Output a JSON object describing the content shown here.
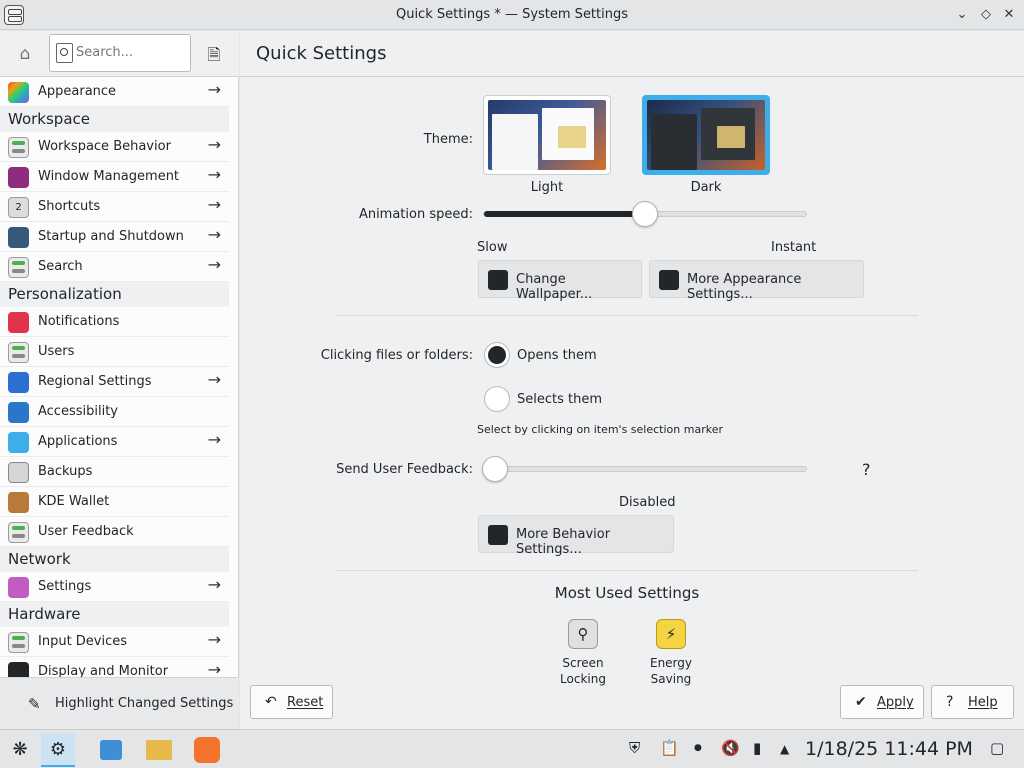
{
  "window": {
    "title": "Quick Settings * — System Settings"
  },
  "sidebar": {
    "search_placeholder": "Search...",
    "sections": {
      "appearance": "Appearance",
      "workspace_header": "Workspace",
      "workspace_items": [
        "Workspace Behavior",
        "Window Management",
        "Shortcuts",
        "Startup and Shutdown",
        "Search"
      ],
      "personalization_header": "Personalization",
      "personalization_items": [
        "Notifications",
        "Users",
        "Regional Settings",
        "Accessibility",
        "Applications",
        "Backups",
        "KDE Wallet",
        "User Feedback"
      ],
      "network_header": "Network",
      "network_items": [
        "Settings"
      ],
      "hardware_header": "Hardware",
      "hardware_items": [
        "Input Devices",
        "Display and Monitor"
      ]
    },
    "highlight_label": "Highlight Changed Settings"
  },
  "main": {
    "title": "Quick Settings",
    "theme_label": "Theme:",
    "themes": [
      "Light",
      "Dark"
    ],
    "selected_theme": "Dark",
    "animation_label": "Animation speed:",
    "animation_value": 0.5,
    "anim_slow": "Slow",
    "anim_instant": "Instant",
    "change_wallpaper": "Change Wallpaper...",
    "more_appearance": "More Appearance Settings...",
    "clicking_label": "Clicking files or folders:",
    "opens_them": "Opens them",
    "selects_them": "Selects them",
    "selects_hint": "Select by clicking on item's selection marker",
    "feedback_label": "Send User Feedback:",
    "feedback_value": 0,
    "feedback_state": "Disabled",
    "help_q": "?",
    "more_behavior": "More Behavior Settings...",
    "most_used_title": "Most Used Settings",
    "most_used": [
      "Screen Locking",
      "Energy Saving"
    ],
    "reset": "Reset",
    "apply": "Apply",
    "help": "Help"
  },
  "taskbar": {
    "clock": "1/18/25 11:44 PM"
  },
  "colors": {
    "accent": "#3daee9",
    "sidebar_bg": "#fcfcfc",
    "main_bg": "#eff0f1"
  }
}
